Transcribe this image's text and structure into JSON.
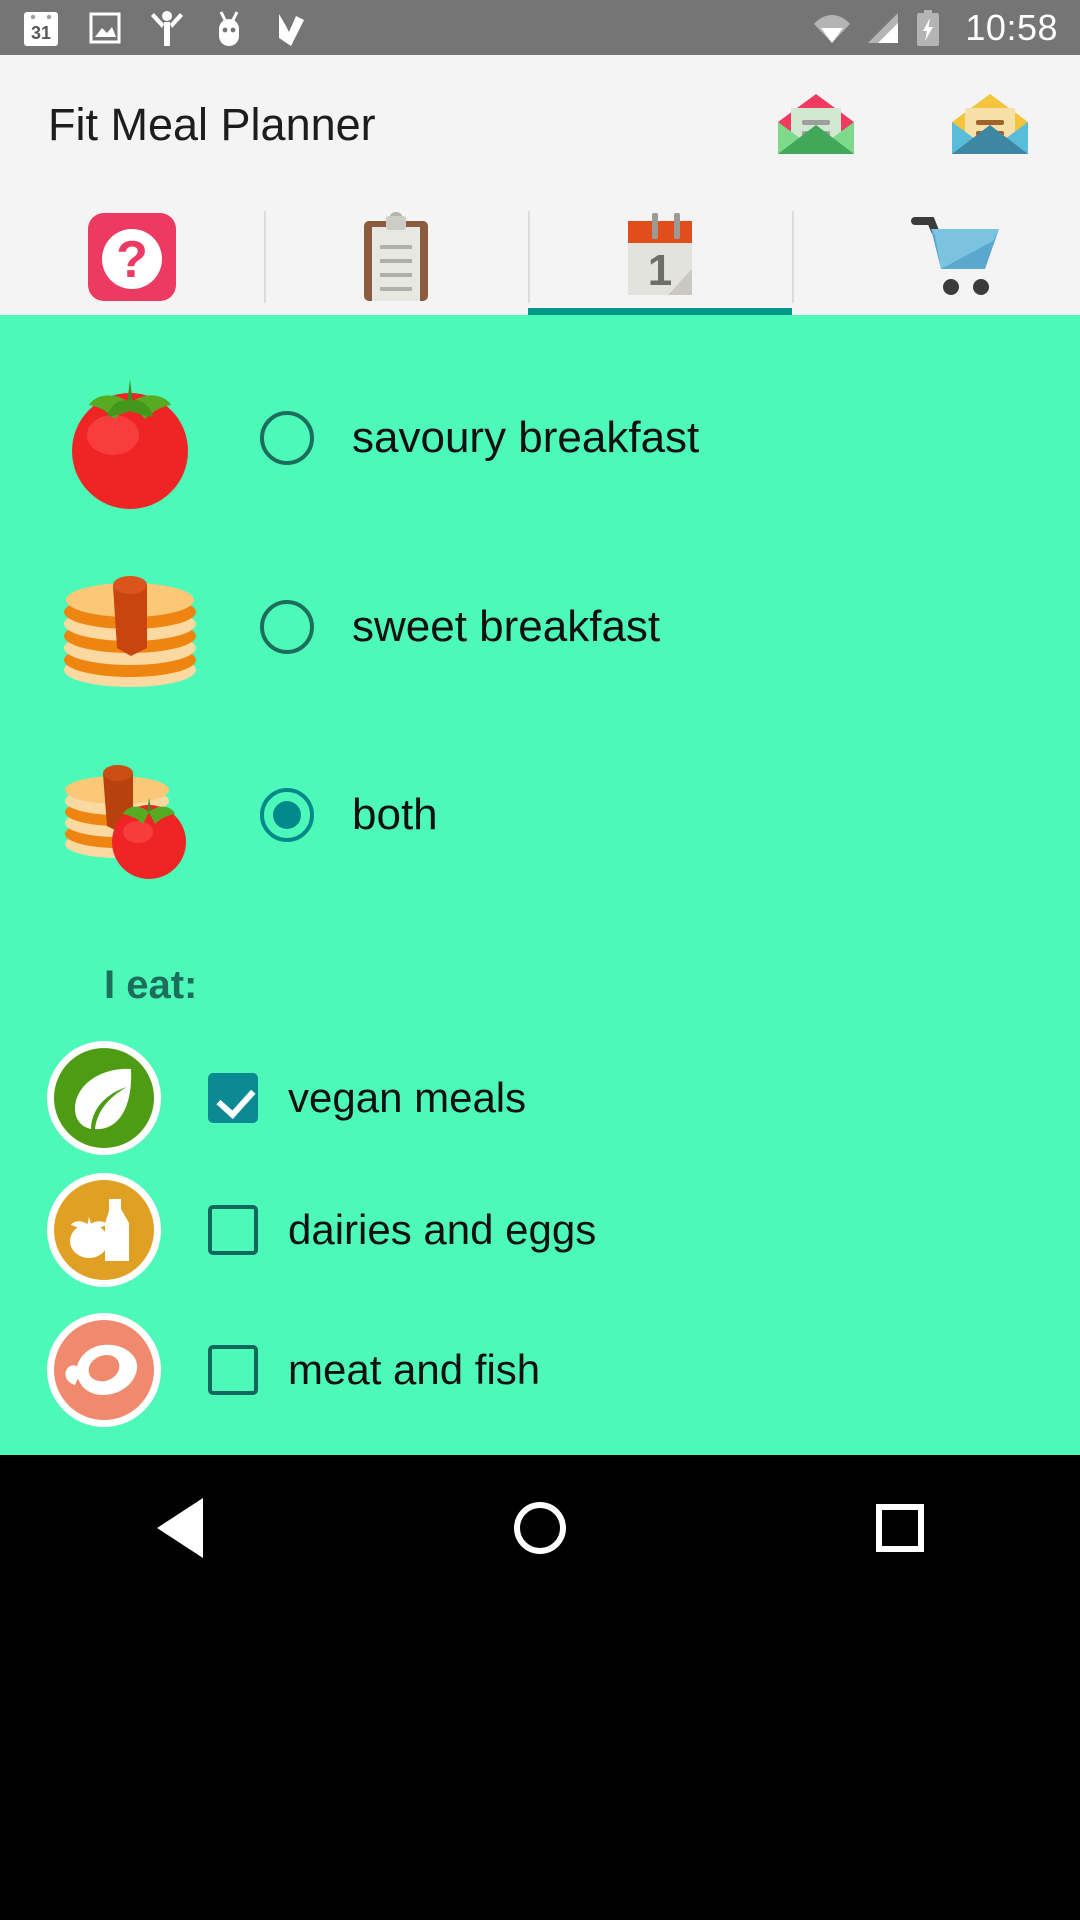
{
  "status_bar": {
    "time": "10:58",
    "left_icons": [
      "calendar-31-icon",
      "gallery-icon",
      "person-icon",
      "android-icon",
      "checkmark-icon"
    ],
    "calendar_day": "31",
    "right_icons": [
      "wifi-icon",
      "signal-icon",
      "battery-charging-icon"
    ],
    "background": "#757575"
  },
  "app_bar": {
    "title": "Fit Meal Planner",
    "actions": [
      "envelope-pink-icon",
      "envelope-yellow-icon"
    ],
    "background": "#f4f4f4"
  },
  "tabs": {
    "active_index": 2,
    "indicator_color": "#009688",
    "items": [
      {
        "name": "help",
        "icon": "question-mark-icon"
      },
      {
        "name": "recipes",
        "icon": "clipboard-icon"
      },
      {
        "name": "planner",
        "icon": "calendar-icon",
        "calendar_day": "1"
      },
      {
        "name": "shopping",
        "icon": "shopping-cart-icon"
      }
    ]
  },
  "content": {
    "background": "#4df9b8",
    "breakfast_options": [
      {
        "label": "savoury breakfast",
        "icon": "tomato-icon",
        "selected": false
      },
      {
        "label": "sweet breakfast",
        "icon": "pancakes-icon",
        "selected": false
      },
      {
        "label": "both",
        "icon": "pancakes-and-tomato-icon",
        "selected": true
      }
    ],
    "diet_section_title": "I eat:",
    "diet_options": [
      {
        "label": "vegan meals",
        "icon": "leaf-icon",
        "checked": true,
        "badge_color": "#4e9c13"
      },
      {
        "label": "dairies and eggs",
        "icon": "milk-bottle-icon",
        "checked": false,
        "badge_color": "#e0a024"
      },
      {
        "label": "meat and fish",
        "icon": "meat-icon",
        "checked": false,
        "badge_color": "#f08a6e"
      }
    ]
  },
  "nav_bar": {
    "buttons": [
      "back-icon",
      "home-icon",
      "recents-icon"
    ],
    "background": "#000000"
  }
}
